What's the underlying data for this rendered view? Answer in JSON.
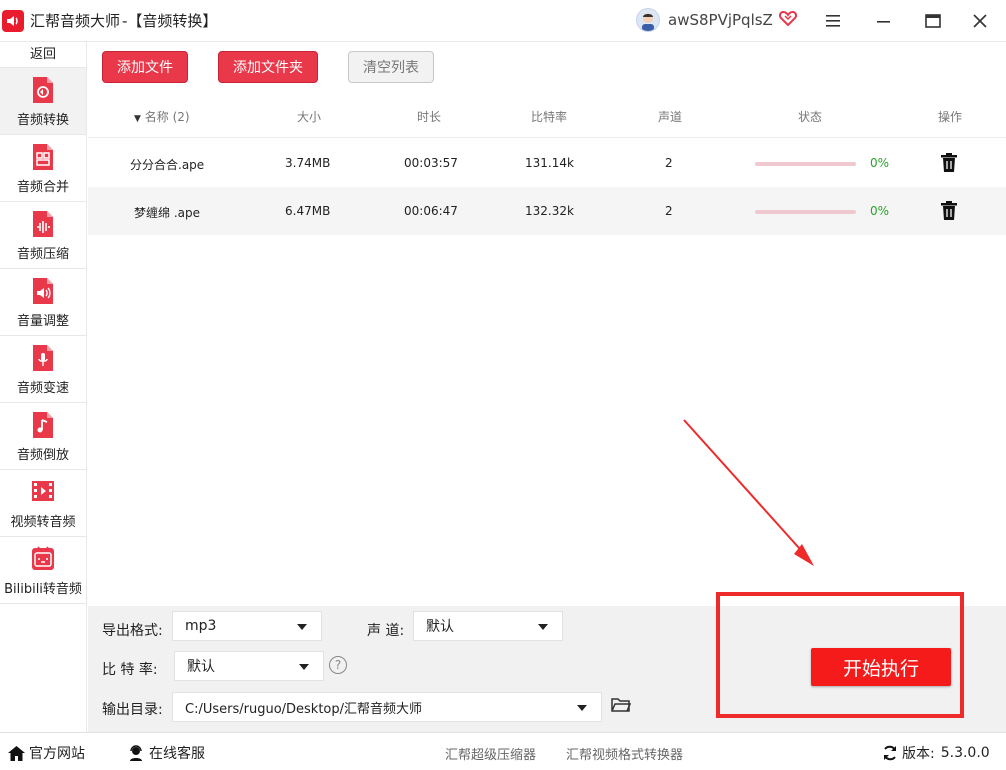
{
  "window": {
    "app_name": "汇帮音频大师",
    "section": "  -【音频转换】",
    "username": "awS8PVjPqlsZ"
  },
  "sidebar": {
    "back": "返回",
    "items": [
      {
        "label": "音频转换",
        "icon": "audio-convert-icon",
        "active": true
      },
      {
        "label": "音频合并",
        "icon": "audio-merge-icon",
        "active": false
      },
      {
        "label": "音频压缩",
        "icon": "audio-compress-icon",
        "active": false
      },
      {
        "label": "音量调整",
        "icon": "volume-adjust-icon",
        "active": false
      },
      {
        "label": "音频变速",
        "icon": "audio-speed-icon",
        "active": false
      },
      {
        "label": "音频倒放",
        "icon": "audio-reverse-icon",
        "active": false
      },
      {
        "label": "视频转音频",
        "icon": "video-to-audio-icon",
        "active": false
      },
      {
        "label": "Bilibili转音频",
        "icon": "bilibili-icon",
        "active": false
      }
    ]
  },
  "toolbar": {
    "add_file": "添加文件",
    "add_folder": "添加文件夹",
    "clear_list": "清空列表"
  },
  "table": {
    "headers": {
      "name": "名称 (2)",
      "size": "大小",
      "duration": "时长",
      "bitrate": "比特率",
      "channels": "声道",
      "status": "状态",
      "action": "操作"
    },
    "rows": [
      {
        "name": "分分合合.ape",
        "size": "3.74MB",
        "duration": "00:03:57",
        "bitrate": "131.14k",
        "channels": "2",
        "progress": 0,
        "progress_text": "0%"
      },
      {
        "name": "梦缠绵 .ape",
        "size": "6.47MB",
        "duration": "00:06:47",
        "bitrate": "132.32k",
        "channels": "2",
        "progress": 0,
        "progress_text": "0%"
      }
    ]
  },
  "settings": {
    "format_label": "导出格式:",
    "format_value": "mp3",
    "channel_label": "声 道:",
    "channel_value": "默认",
    "bitrate_label": "比 特 率:",
    "bitrate_value": "默认",
    "help": "?",
    "output_label": "输出目录:",
    "output_value": "C:/Users/ruguo/Desktop/汇帮音频大师",
    "start": "开始执行"
  },
  "footer": {
    "website": "官方网站",
    "support": "在线客服",
    "link1": "汇帮超级压缩器",
    "link2": "汇帮视频格式转换器",
    "version_label": "版本:",
    "version": "5.3.0.0"
  },
  "colors": {
    "accent": "#e8384a",
    "start_button": "#f51b1b",
    "progress_text": "#29a329",
    "highlight": "#ee2a2a"
  }
}
